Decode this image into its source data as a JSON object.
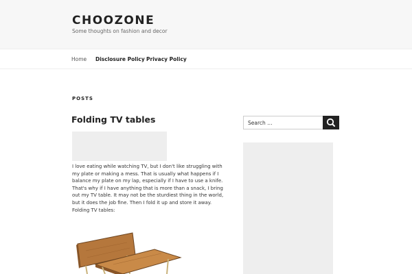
{
  "site": {
    "title": "CHOOZONE",
    "description": "Some thoughts on fashion and decor"
  },
  "nav": {
    "items": [
      {
        "label": "Home"
      },
      {
        "label": "Disclosure Policy"
      },
      {
        "label": "Privacy Policy"
      }
    ]
  },
  "main": {
    "posts_heading": "POSTS",
    "post": {
      "title": "Folding TV tables",
      "paragraphs": [
        "I love eating while watching TV, but I don't like struggling with my plate or making a mess. That is usually what happens if I balance my plate on my lap, especially if I have to use a knife. That's why if I have anything that is more than a snack, I bring out my TV table. It may not be the sturdiest thing in the world, but it does the job fine. Then I fold it up and store it away.",
        "Folding TV tables:"
      ]
    }
  },
  "sidebar": {
    "search": {
      "placeholder": "Search …"
    }
  },
  "icons": {
    "search_button": "search-icon"
  },
  "colors": {
    "header_bg": "#f7f7f7",
    "search_button_bg": "#222222",
    "placeholder_bg": "#eeeeee",
    "wood": "#b5773c"
  }
}
